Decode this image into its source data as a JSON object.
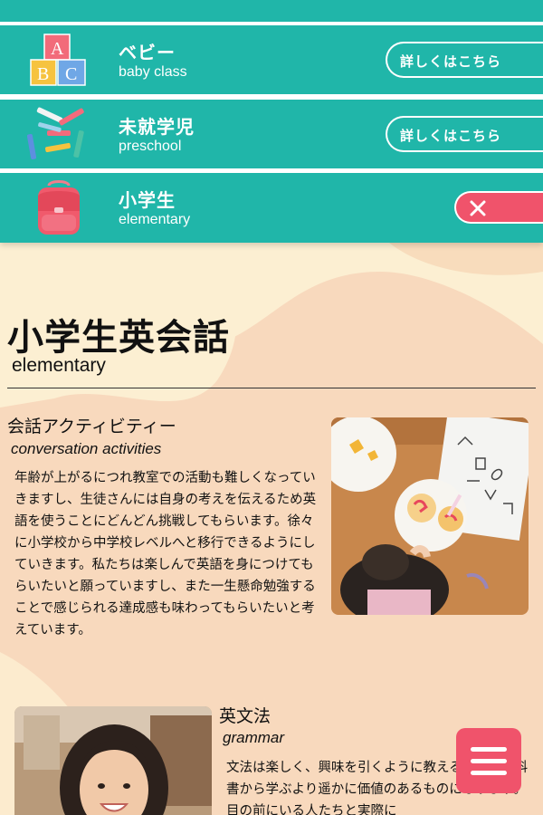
{
  "menu": {
    "items": [
      {
        "title": "ベビー",
        "subtitle": "baby class",
        "button": "詳しくはこちら",
        "icon": "abc-blocks-icon"
      },
      {
        "title": "未就学児",
        "subtitle": "preschool",
        "button": "詳しくはこちら",
        "icon": "crayons-icon"
      },
      {
        "title": "小学生",
        "subtitle": "elementary",
        "button": "",
        "icon": "school-backpack-icon",
        "active": true
      }
    ],
    "close_icon": "close-icon"
  },
  "page": {
    "title": "小学生英会話",
    "subtitle": "elementary"
  },
  "sections": [
    {
      "title": "会話アクティビティー",
      "subtitle": "conversation activities",
      "body": "年齢が上がるにつれ教室での活動も難しくなっていきますし、生徒さんには自身の考えを伝えるため英語を使うことにどんどん挑戦してもらいます。徐々に小学校から中学校レベルへと移行できるようにしていきます。私たちは楽しんで英語を身につけてもらいたいと願っていますし、また一生懸命勉強することで感じられる達成感も味わってもらいたいと考えています。",
      "image": "child-decorating-cookies-photo"
    },
    {
      "title": "英文法",
      "subtitle": "grammar",
      "body": "文法は楽しく、興味を引くように教えるでただ教科書から学ぶより遥かに価値のあるものになります。目の前にいる人たちと実際に",
      "image": "smiling-girl-photo"
    }
  ],
  "fab": {
    "icon": "hamburger-menu-icon"
  },
  "colors": {
    "teal": "#20b6a9",
    "pink": "#f0536b",
    "background": "#f8d9bd",
    "cream": "#fcefd2"
  }
}
